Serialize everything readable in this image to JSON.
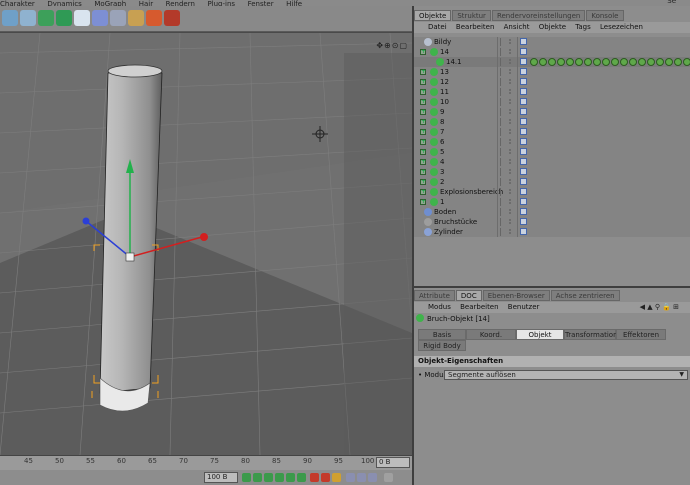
{
  "menu": {
    "items": [
      "Charakter",
      "Dynamics",
      "MoGraph",
      "Hair",
      "Rendern",
      "Plug-ins",
      "Fenster",
      "Hilfe"
    ],
    "corner": "Se"
  },
  "timeline": {
    "ticks": [
      "45",
      "50",
      "55",
      "60",
      "65",
      "70",
      "75",
      "80",
      "85",
      "90",
      "95",
      "100"
    ],
    "current_frame": "0 B",
    "end_frame": "100 B"
  },
  "object_manager": {
    "tabs": [
      "Objekte",
      "Struktur",
      "Rendervoreinstellungen",
      "Konsole"
    ],
    "active_tab": 0,
    "menu": [
      "Datei",
      "Bearbeiten",
      "Ansicht",
      "Objekte",
      "Tags",
      "Lesezeichen"
    ],
    "objects": [
      {
        "name": "Bildy",
        "depth": 0,
        "color": "#b7c0cf"
      },
      {
        "name": "14",
        "depth": 1,
        "color": "#3fb34b",
        "expand": true
      },
      {
        "name": "14.1",
        "depth": 2,
        "color": "#3fb34b"
      },
      {
        "name": "13",
        "depth": 1,
        "color": "#3fb34b",
        "expand": true
      },
      {
        "name": "12",
        "depth": 1,
        "color": "#3fb34b",
        "expand": true
      },
      {
        "name": "11",
        "depth": 1,
        "color": "#3fb34b",
        "expand": true
      },
      {
        "name": "10",
        "depth": 1,
        "color": "#3fb34b",
        "expand": true
      },
      {
        "name": "9",
        "depth": 1,
        "color": "#3fb34b",
        "expand": true
      },
      {
        "name": "8",
        "depth": 1,
        "color": "#3fb34b",
        "expand": true
      },
      {
        "name": "7",
        "depth": 1,
        "color": "#3fb34b",
        "expand": true
      },
      {
        "name": "6",
        "depth": 1,
        "color": "#3fb34b",
        "expand": true
      },
      {
        "name": "5",
        "depth": 1,
        "color": "#3fb34b",
        "expand": true
      },
      {
        "name": "4",
        "depth": 1,
        "color": "#3fb34b",
        "expand": true
      },
      {
        "name": "3",
        "depth": 1,
        "color": "#3fb34b",
        "expand": true
      },
      {
        "name": "2",
        "depth": 1,
        "color": "#3fb34b",
        "expand": true
      },
      {
        "name": "Explosionsbereich",
        "depth": 1,
        "color": "#3fb34b",
        "expand": true
      },
      {
        "name": "1",
        "depth": 1,
        "color": "#3fb34b",
        "expand": true
      },
      {
        "name": "Boden",
        "depth": 0,
        "color": "#6f8ed0"
      },
      {
        "name": "Bruchstücke",
        "depth": 0,
        "color": "#9d9d9d"
      },
      {
        "name": "Zylinder",
        "depth": 0,
        "color": "#8aa2d6"
      }
    ]
  },
  "attribute_manager": {
    "tabs": [
      "Attribute",
      "DOC",
      "Ebenen-Browser",
      "Achse zentrieren"
    ],
    "active_tab": 1,
    "menu": [
      "Modus",
      "Bearbeiten",
      "Benutzer"
    ],
    "title": "Bruch-Objekt [14]",
    "property_tabs": [
      "Basis",
      "Koord.",
      "Objekt",
      "Transformation",
      "Effektoren",
      "Rigid Body"
    ],
    "active_property_tab": 2,
    "section": "Objekt-Eigenschaften",
    "modus_label": "Modus",
    "modus_value": "Segmente auflösen"
  },
  "colors": {
    "viewport_bg": "#6e6e6e",
    "panel_bg": "#8d8d8d",
    "axis_y": "#22b14c",
    "axis_x": "#d21f1f",
    "axis_z": "#2b3fd6",
    "selection": "#f0a020"
  }
}
